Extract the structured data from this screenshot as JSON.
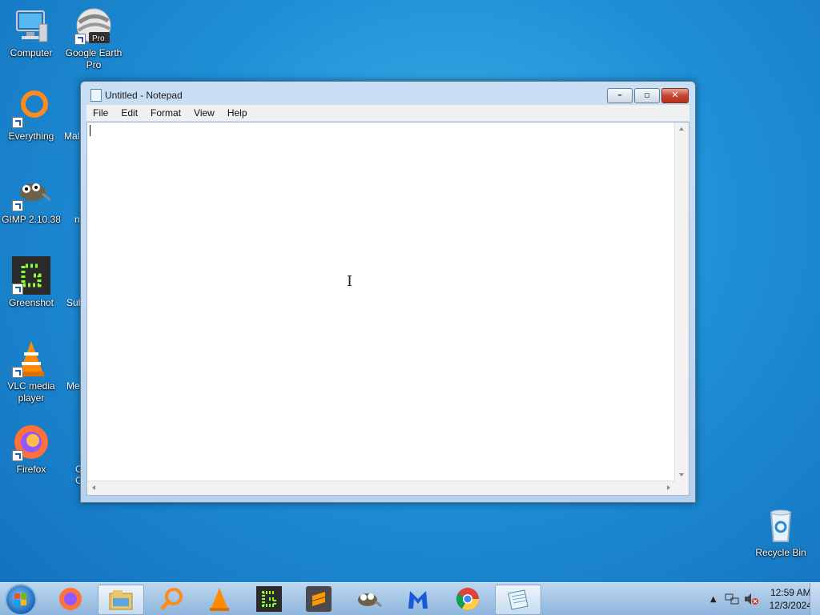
{
  "desktop": {
    "icons": [
      {
        "label": "Computer"
      },
      {
        "label": "Google Earth\nPro",
        "badge": "Pro"
      },
      {
        "label": "Everything"
      },
      {
        "label": "GIMP 2.10.38"
      },
      {
        "label": "Greenshot"
      },
      {
        "label": "VLC media\nplayer"
      },
      {
        "label": "Firefox"
      },
      {
        "label": "Recycle Bin"
      }
    ],
    "partial_labels": [
      "Mal",
      "n",
      "Sub",
      "Me",
      "C\nC"
    ]
  },
  "notepad": {
    "title": "Untitled - Notepad",
    "menu": [
      "File",
      "Edit",
      "Format",
      "View",
      "Help"
    ],
    "content": ""
  },
  "taskbar": {
    "apps": [
      "firefox-icon",
      "file-explorer-icon",
      "everything-search-icon",
      "vlc-icon",
      "greenshot-icon",
      "sublime-text-icon",
      "gimp-icon",
      "malwarebytes-icon",
      "chrome-icon",
      "notepad-icon"
    ],
    "clock_time": "12:59 AM",
    "clock_date": "12/3/2024"
  },
  "colors": {
    "desktop": "#1e8fd6",
    "taskbar": "#a9c7e7",
    "window_frame": "#bed5ee"
  }
}
